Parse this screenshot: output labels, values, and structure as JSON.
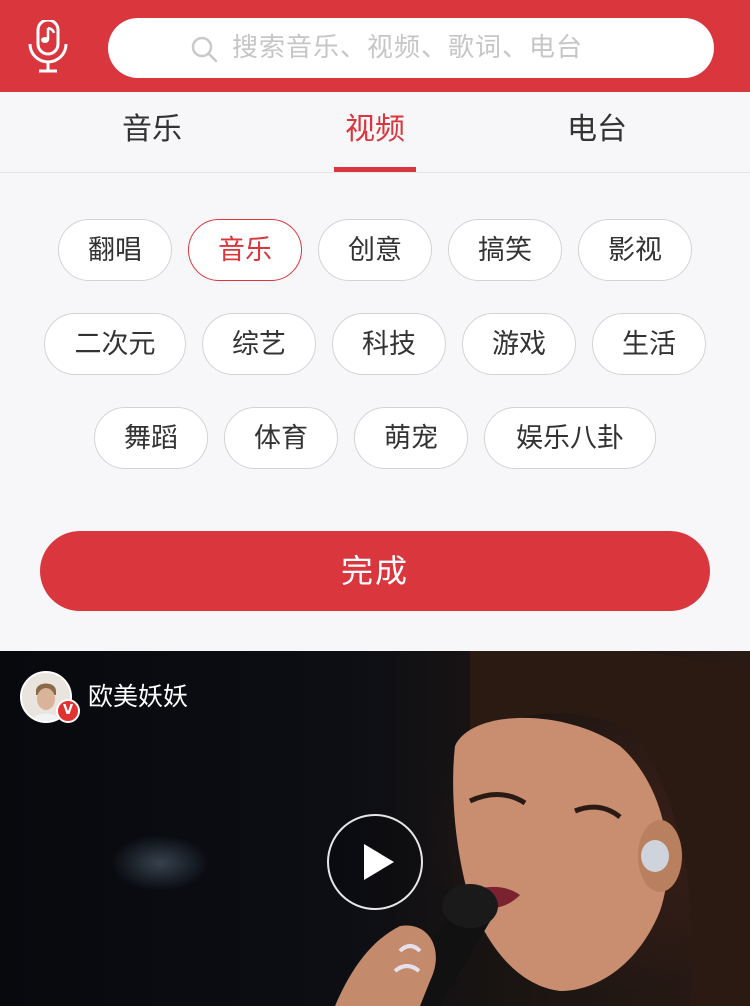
{
  "header": {
    "mic_icon": "microphone-music-icon",
    "search": {
      "icon": "search-icon",
      "placeholder": "搜索音乐、视频、歌词、电台"
    },
    "accent_color": "#d9363e"
  },
  "tabs": [
    {
      "label": "音乐",
      "active": false
    },
    {
      "label": "视频",
      "active": true
    },
    {
      "label": "电台",
      "active": false
    }
  ],
  "tags": [
    {
      "label": "翻唱",
      "selected": false
    },
    {
      "label": "音乐",
      "selected": true
    },
    {
      "label": "创意",
      "selected": false
    },
    {
      "label": "搞笑",
      "selected": false
    },
    {
      "label": "影视",
      "selected": false
    },
    {
      "label": "二次元",
      "selected": false
    },
    {
      "label": "综艺",
      "selected": false
    },
    {
      "label": "科技",
      "selected": false
    },
    {
      "label": "游戏",
      "selected": false
    },
    {
      "label": "生活",
      "selected": false
    },
    {
      "label": "舞蹈",
      "selected": false
    },
    {
      "label": "体育",
      "selected": false
    },
    {
      "label": "萌宠",
      "selected": false
    },
    {
      "label": "娱乐八卦",
      "selected": false
    }
  ],
  "done_button": {
    "label": "完成"
  },
  "video_card": {
    "uploader": "欧美妖妖",
    "verified_badge": "V",
    "play_icon": "play-icon"
  }
}
